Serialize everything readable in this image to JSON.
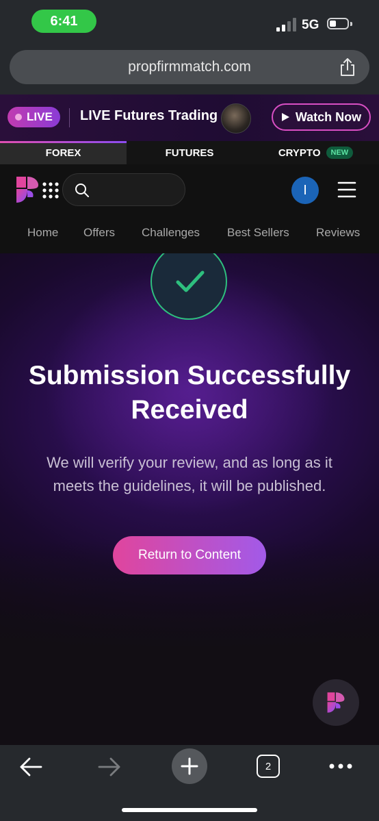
{
  "status_bar": {
    "time": "6:41",
    "network": "5G"
  },
  "browser": {
    "url": "propfirmmatch.com"
  },
  "live_banner": {
    "badge": "LIVE",
    "title": "LIVE Futures Trading",
    "button": "Watch Now"
  },
  "market_tabs": [
    {
      "label": "FOREX",
      "active": true
    },
    {
      "label": "FUTURES",
      "active": false
    },
    {
      "label": "CRYPTO",
      "active": false,
      "badge": "NEW"
    }
  ],
  "header": {
    "user_initial": "I"
  },
  "nav": [
    "Home",
    "Offers",
    "Challenges",
    "Best Sellers",
    "Reviews"
  ],
  "hero": {
    "title_line1": "Submission Successfully",
    "title_line2": "Received",
    "desc_line1": "We will verify your review, and as long as it",
    "desc_line2": "meets the guidelines, it will be published.",
    "button": "Return to Content"
  },
  "toolbar": {
    "tab_count": "2"
  },
  "colors": {
    "accent_pink": "#e0459d",
    "accent_purple": "#a25ae8",
    "success_green": "#2ebf7e"
  }
}
